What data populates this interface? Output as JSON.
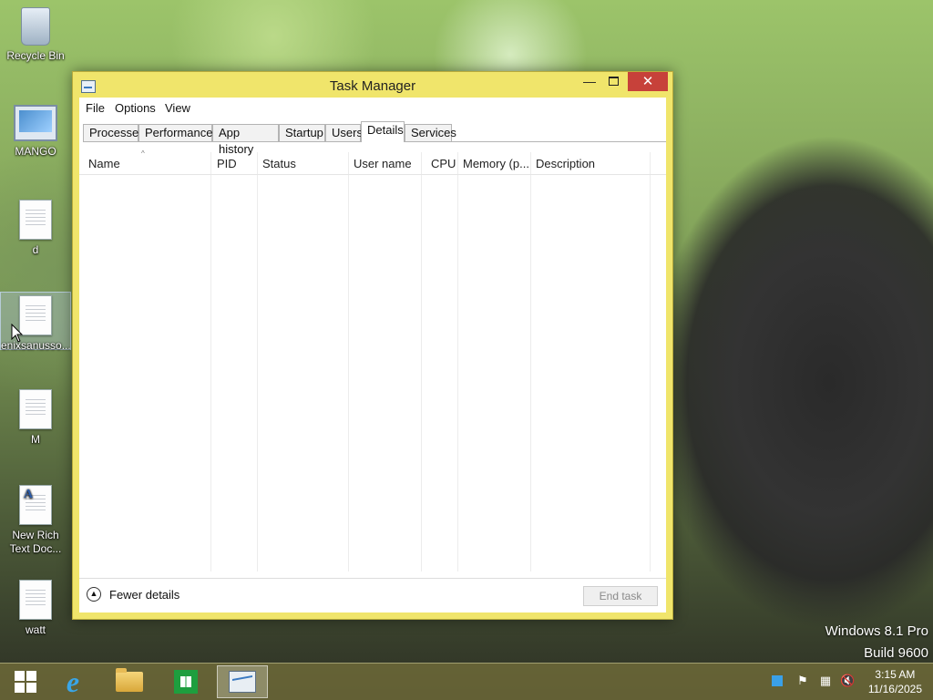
{
  "desktop": {
    "icons": [
      {
        "label": "Recycle Bin"
      },
      {
        "label": "MANGO"
      },
      {
        "label": "d"
      },
      {
        "label": "enixsanusso..."
      },
      {
        "label": "M"
      },
      {
        "label": "New Rich\nText Doc..."
      },
      {
        "label": "watt"
      }
    ],
    "watermark": {
      "line1": "Windows 8.1 Pro",
      "line2": "Build 9600"
    }
  },
  "window": {
    "title": "Task Manager",
    "controls": {
      "minimize": "—",
      "close": "✕"
    },
    "menu": [
      "File",
      "Options",
      "View"
    ],
    "tabs": [
      "Processes",
      "Performance",
      "App history",
      "Startup",
      "Users",
      "Details",
      "Services"
    ],
    "active_tab": "Details",
    "columns": [
      "Name",
      "PID",
      "Status",
      "User name",
      "CPU",
      "Memory (p...",
      "Description"
    ],
    "sort_indicator": "^",
    "footer": {
      "fewer_details": "Fewer details",
      "end_task": "End task"
    }
  },
  "taskbar": {
    "clock": {
      "time": "3:15 AM",
      "date": "11/16/2025"
    }
  }
}
